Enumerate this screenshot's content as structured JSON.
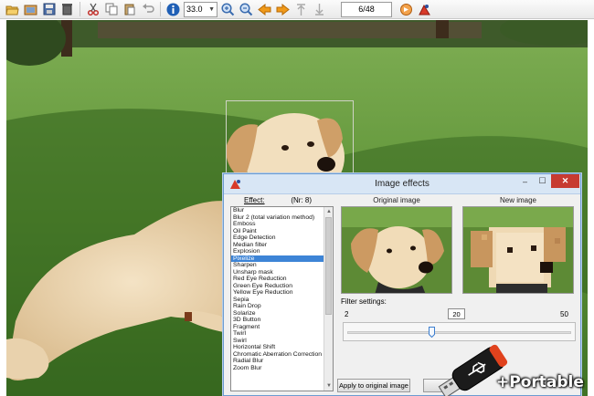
{
  "toolbar": {
    "icons": [
      "open-folder-icon",
      "thumbnails-icon",
      "save-icon",
      "delete-icon",
      "cut-icon",
      "copy-icon",
      "paste-icon",
      "undo-icon",
      "info-icon",
      "zoom-in-icon",
      "zoom-out-icon",
      "previous-icon",
      "next-icon",
      "first-page-icon",
      "last-page-icon",
      "slideshow-icon",
      "settings-icon"
    ],
    "zoom_value": "33.0",
    "page_counter": "6/48"
  },
  "dialog": {
    "title": "Image effects",
    "effect_label": "Effect:",
    "effect_count": "(Nr: 8)",
    "original_label": "Original image",
    "new_label": "New image",
    "effects": [
      "Blur",
      "Blur 2 (total variation method)",
      "Emboss",
      "Oil Paint",
      "Edge Detection",
      "Median filter",
      "Explosion",
      "Pixelize",
      "Sharpen",
      "Unsharp mask",
      "Red Eye Reduction",
      "Green Eye Reduction",
      "Yellow Eye Reduction",
      "Sepia",
      "Rain Drop",
      "Solarize",
      "3D Button",
      "Fragment",
      "Twirl",
      "Swirl",
      "Horizontal Shift",
      "Chromatic Aberration Correction",
      "Radial Blur",
      "Zoom Blur"
    ],
    "selected_effect": "Pixelize",
    "filter_settings_label": "Filter settings:",
    "slider_min": "2",
    "slider_max": "50",
    "slider_value": "20",
    "apply_original_label": "Apply to original image"
  },
  "badge": {
    "text": "+Portable"
  },
  "colors": {
    "selection": "#3d84d6",
    "close_button": "#c73b31",
    "title_bar": "#d8e6f5"
  }
}
